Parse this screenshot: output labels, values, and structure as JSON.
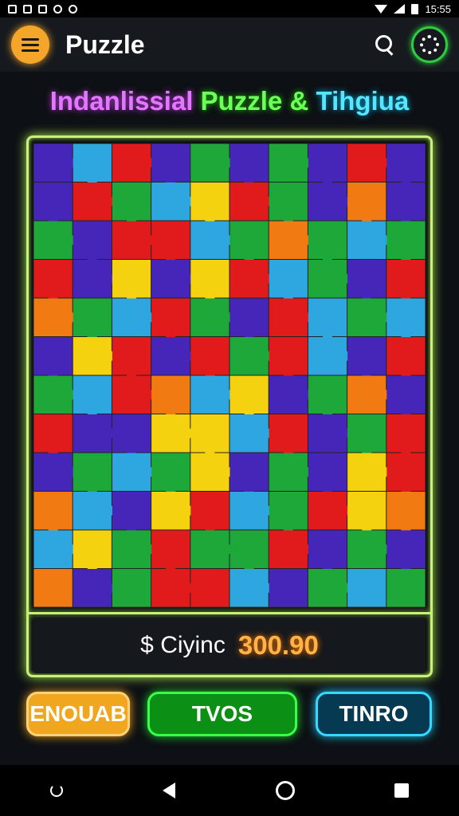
{
  "status_bar": {
    "time": "15:55"
  },
  "header": {
    "title": "Puzzle"
  },
  "game_title": {
    "part1": "Indanlissial",
    "part2": "Puzzle &",
    "part3": "Tihgiua"
  },
  "score": {
    "label": "$ Ciyinc",
    "value": "300.90"
  },
  "buttons": {
    "left": "ENOUAB",
    "center": "TVOS",
    "right": "TINRO"
  },
  "colors": {
    "menu_accent": "#f4a62a",
    "settings_accent": "#2ecc40",
    "frame_glow": "#c8f07a",
    "score_value": "#ffb347",
    "btn_left": "#f0a61f",
    "btn_center": "#0b8f14",
    "btn_right": "#063a52",
    "puzzle_palette": [
      "#e11b1b",
      "#1fa83a",
      "#4526b8",
      "#f4d20f",
      "#2ea7e0",
      "#f27a12",
      "#8b2bb5"
    ]
  },
  "puzzle": {
    "columns": 10,
    "rows": 12,
    "grid": [
      "PBRPGPGPRP",
      "PRGBYRGPOP",
      "GPRRBGOGBG",
      "RPYPYRBGPR",
      "OGBRGPRBGB",
      "PYRPRGRBPR",
      "GBROBYPGOP",
      "RPPYYBRPGR",
      "PGBGYPGPYR",
      "OBPYRBGRYO",
      "BYGRGGRPGP",
      "OPGRRBPGBG"
    ]
  },
  "icons": {
    "menu": "hamburger-menu-icon",
    "search": "search-icon",
    "settings": "gear-icon",
    "nav_back": "triangle-back-icon",
    "nav_home": "circle-home-icon",
    "nav_recent": "square-recent-icon"
  }
}
